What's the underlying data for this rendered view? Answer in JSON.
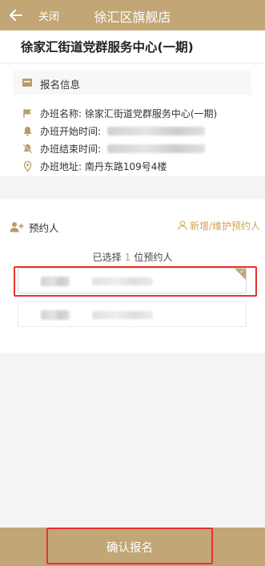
{
  "topbar": {
    "close_label": "关闭",
    "title": "徐汇区旗舰店"
  },
  "header": {
    "title": "徐家汇街道党群服务中心(一期)"
  },
  "info": {
    "section_title": "报名信息",
    "rows": [
      {
        "icon": "flag-icon",
        "label": "办班名称: 徐家汇街道党群服务中心(一期)"
      },
      {
        "icon": "bell-icon",
        "label": "办班开始时间:"
      },
      {
        "icon": "bell-off-icon",
        "label": "办班结束时间:"
      },
      {
        "icon": "location-pin-icon",
        "label": "办班地址: 南丹东路109号4楼"
      }
    ]
  },
  "booker": {
    "title": "预约人",
    "add_link": "新增/维护预约人",
    "selected_prefix": "已选择",
    "selected_count": "1",
    "selected_suffix": "位预约人",
    "people": [
      {
        "selected": true
      },
      {
        "selected": false
      }
    ]
  },
  "footer": {
    "confirm_label": "确认报名"
  },
  "colors": {
    "accent": "#c2a676",
    "link": "#d5a24f",
    "highlight": "#e8312f"
  }
}
